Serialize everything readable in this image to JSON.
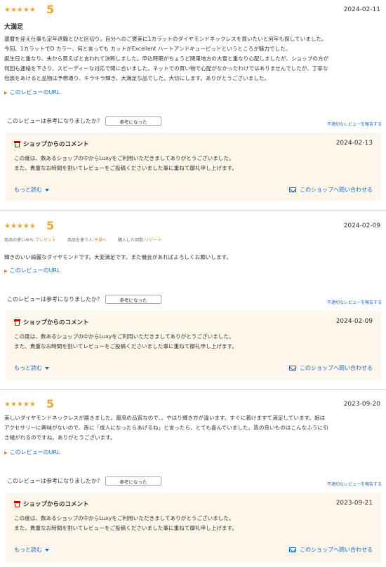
{
  "reviews": [
    {
      "stars": "★★★★★",
      "score": "5",
      "date": "2024-02-11",
      "title": "大満足",
      "body": [
        "還暦を迎え仕事も定年退職とひと区切り。自分へのご褒美に1カラットのダイヤモンドネックレスを買いたいと何年も探していました。",
        "今回、1カラットでD カラー、何と言っても カットがExcellent ハートアンドキューピッドというところが魅力でした。",
        "誕生日と重なり、夫から買えばと言われて決断しました。申込時期がちょうど関東地方の大雪と重なり心配しましたが、ショップの方が",
        "何回も連絡を下さり、スピーディーな対応で間に合いました。ネットでの買い物で心配がなかったわけではありませんでしたが、丁寧な",
        "包装をあけると品物は予想通り、キラキラ輝き、大満足な品でした。大切にします。ありがとうございました。"
      ],
      "url_label": "このレビューのURL",
      "helpful_q": "このレビューは参考になりましたか？",
      "helpful_btn": "参考になった",
      "report": "不適切なレビューを報告する",
      "shop_head": "ショップからのコメント",
      "shop_date": "2024-02-13",
      "shop_text": [
        "この度は、数あるショップの中からLuxyをご利用いただきましてありがとうございました。",
        "また、貴重なお時間を割いてレビューをご投稿くださいました事に重ねて御礼申し上げます。"
      ],
      "more": "もっと読む",
      "contact": "このショップへ問い合わせる"
    },
    {
      "stars": "★★★★★",
      "score": "5",
      "date": "2024-02-09",
      "meta": [
        {
          "k": "商品の使いみち:",
          "v": "プレゼント"
        },
        {
          "k": "商品を使う人:",
          "v": "子供へ"
        },
        {
          "k": "購入した回数:",
          "v": "リピート"
        }
      ],
      "body": [
        "輝きのいい綺麗なダイヤモンドです。大変満足です。また機会があればよろしくお願いします。"
      ],
      "url_label": "このレビューのURL",
      "helpful_q": "このレビューは参考になりましたか？",
      "helpful_btn": "参考になった",
      "report": "不適切なレビューを報告する",
      "shop_head": "ショップからのコメント",
      "shop_date": "2024-02-09",
      "shop_text": [
        "この度は、数あるショップの中からLuxyをご利用いただきましてありがとうございました。",
        "また、貴重なお時間を割いてレビューをご投稿くださいました事に重ねて御礼申し上げます。"
      ],
      "more": "もっと読む",
      "contact": "このショップへ問い合わせる"
    },
    {
      "stars": "★★★★★",
      "score": "5",
      "date": "2023-09-20",
      "body": [
        "美しいダイヤモンドネックレスが届きました。最高の品質なので、。やはり輝き方が違います。すぐに着けますて満足しています。娘は",
        "アクセサリーに興味がないので、孫に「成人になったらあげるね」と言ったら、とても喜んでいました。質の良いものはこんなふうに引",
        "き継がれるのですね。ありがとうございます。"
      ],
      "url_label": "このレビューのURL",
      "helpful_q": "このレビューは参考になりましたか？",
      "helpful_btn": "参考になった",
      "report": "不適切なレビューを報告する",
      "shop_head": "ショップからのコメント",
      "shop_date": "2023-09-21",
      "shop_text": [
        "この度は、数あるショップの中からLuxyをご利用いただきましてありがとうございました。",
        "また、貴重なお時間を割いてレビューをご投稿くださいました事に重ねて御礼申し上げます。"
      ],
      "more": "もっと読む",
      "contact": "このショップへ問い合わせる"
    }
  ]
}
